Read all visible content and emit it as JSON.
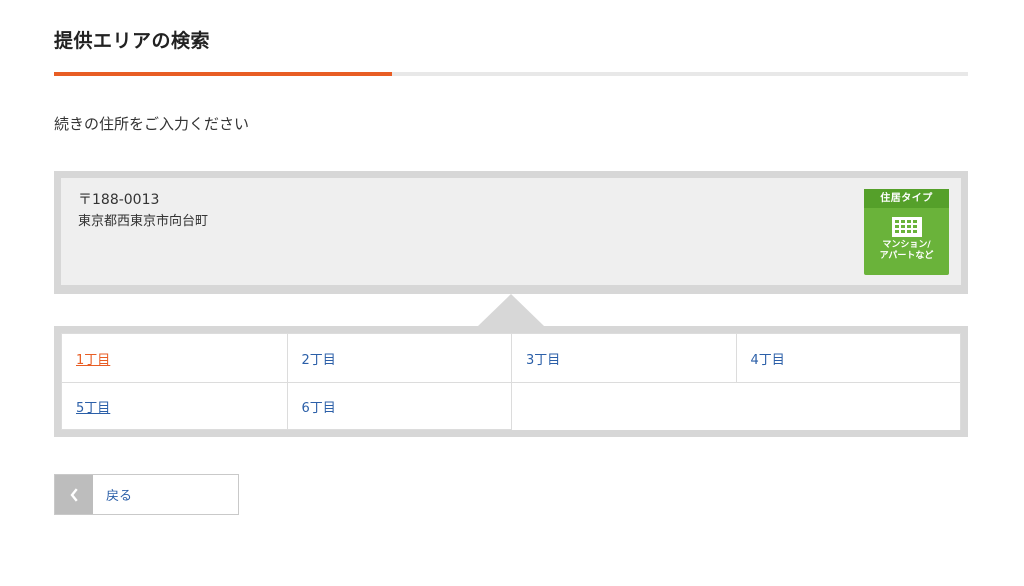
{
  "page": {
    "title": "提供エリアの検索"
  },
  "progress": {
    "fraction": 0.37,
    "color": "#e85d24"
  },
  "instruction": "続きの住所をご入力ください",
  "address": {
    "postal": "〒188-0013",
    "text": "東京都西東京市向台町"
  },
  "residence_type": {
    "header": "住居タイプ",
    "icon": "building-icon",
    "line1": "マンション/",
    "line2": "アパートなど",
    "color": "#6ab33a"
  },
  "choome": {
    "rows": [
      [
        "1丁目",
        "2丁目",
        "3丁目",
        "4丁目"
      ],
      [
        "5丁目",
        "6丁目"
      ]
    ],
    "active": "1丁目",
    "link_color": "#2b5fa8",
    "active_color": "#e85d24"
  },
  "back_button": {
    "label": "戻る",
    "icon": "chevron-left-icon"
  }
}
